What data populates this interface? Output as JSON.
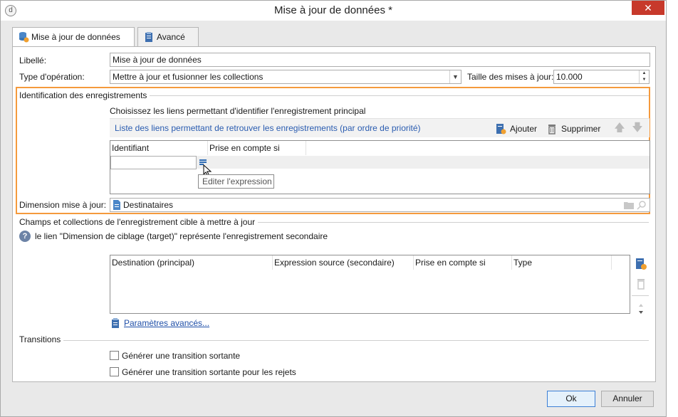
{
  "window": {
    "title": "Mise à jour de données *",
    "close_glyph": "✕",
    "app_glyph": "d"
  },
  "tabs": [
    {
      "label": "Mise à jour de données",
      "icon": "database-update-icon"
    },
    {
      "label": "Avancé",
      "icon": "clipboard-icon"
    }
  ],
  "form": {
    "libelle_label": "Libellé:",
    "libelle_value": "Mise à jour de données",
    "type_label": "Type d'opération:",
    "type_value": "Mettre à jour et fusionner les collections",
    "taille_label": "Taille des mises à jour:",
    "taille_value": "10.000"
  },
  "identification": {
    "group_title": "Identification des enregistrements",
    "instruction": "Choisissez les liens permettant d'identifier l'enregistrement principal",
    "list_title": "Liste des liens permettant de retrouver les enregistrements (par ordre de priorité)",
    "add_label": "Ajouter",
    "delete_label": "Supprimer",
    "columns": [
      "Identifiant",
      "Prise en compte si"
    ],
    "tooltip": "Editer l'expression",
    "dimension_label": "Dimension mise à jour:",
    "dimension_value": "Destinataires"
  },
  "champs": {
    "group_title": "Champs et collections de l'enregistrement cible à mettre à jour",
    "help_text": "le lien \"Dimension de ciblage (target)\" représente l'enregistrement secondaire",
    "columns": [
      "Destination (principal)",
      "Expression source (secondaire)",
      "Prise en compte si",
      "Type"
    ],
    "advanced_link": "Paramètres avancés..."
  },
  "transitions": {
    "group_title": "Transitions",
    "options": [
      {
        "label": "Générer une transition sortante",
        "checked": false
      },
      {
        "label": "Générer une transition sortante pour les rejets",
        "checked": false
      }
    ]
  },
  "footer": {
    "ok_label": "Ok",
    "cancel_label": "Annuler"
  },
  "colors": {
    "highlight_border": "#f59a3c",
    "link": "#1f4fa8",
    "close": "#c7392b"
  }
}
